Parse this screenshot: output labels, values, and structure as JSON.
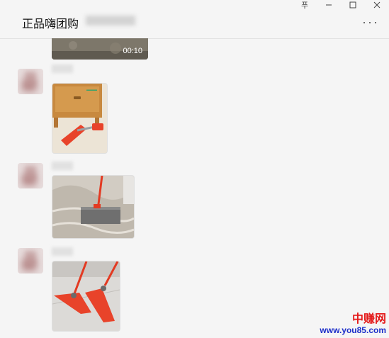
{
  "window": {
    "controls": {
      "pin": "푸",
      "minimize": "−",
      "maximize": "□",
      "close": "×"
    }
  },
  "chat": {
    "title": "正品嗨团购",
    "more": "···"
  },
  "messages": [
    {
      "type": "video",
      "duration": "00:10"
    },
    {
      "type": "image",
      "description_icon": "mop-under-cabinet"
    },
    {
      "type": "image",
      "description_icon": "mop-on-carpet"
    },
    {
      "type": "image",
      "description_icon": "two-mops"
    }
  ],
  "watermark": {
    "brand": "中赚网",
    "url": "www.you85.com"
  }
}
